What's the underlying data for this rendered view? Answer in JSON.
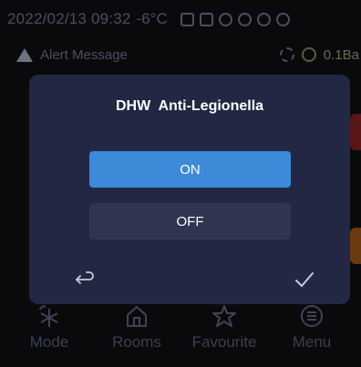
{
  "status_bar": {
    "datetime": "2022/02/13  09:32",
    "temperature": "-6°C"
  },
  "alert": {
    "text": "Alert Message",
    "pressure": "0.1Ba"
  },
  "dialog": {
    "title": "DHW  Anti-Legionella",
    "options": [
      {
        "label": "ON",
        "selected": true
      },
      {
        "label": "OFF",
        "selected": false
      }
    ],
    "back_icon": "return-arrow-icon",
    "confirm_icon": "checkmark-icon"
  },
  "bottom_nav": {
    "items": [
      {
        "label": "Mode",
        "icon": "snowflake-sun-icon"
      },
      {
        "label": "Rooms",
        "icon": "home-icon"
      },
      {
        "label": "Favourite",
        "icon": "star-icon"
      },
      {
        "label": "Menu",
        "icon": "menu-icon"
      }
    ]
  },
  "colors": {
    "dialog_bg": "#222844",
    "selected_option": "#3d8ad8",
    "unselected_option": "#2f3550",
    "text": "#ffffff"
  }
}
